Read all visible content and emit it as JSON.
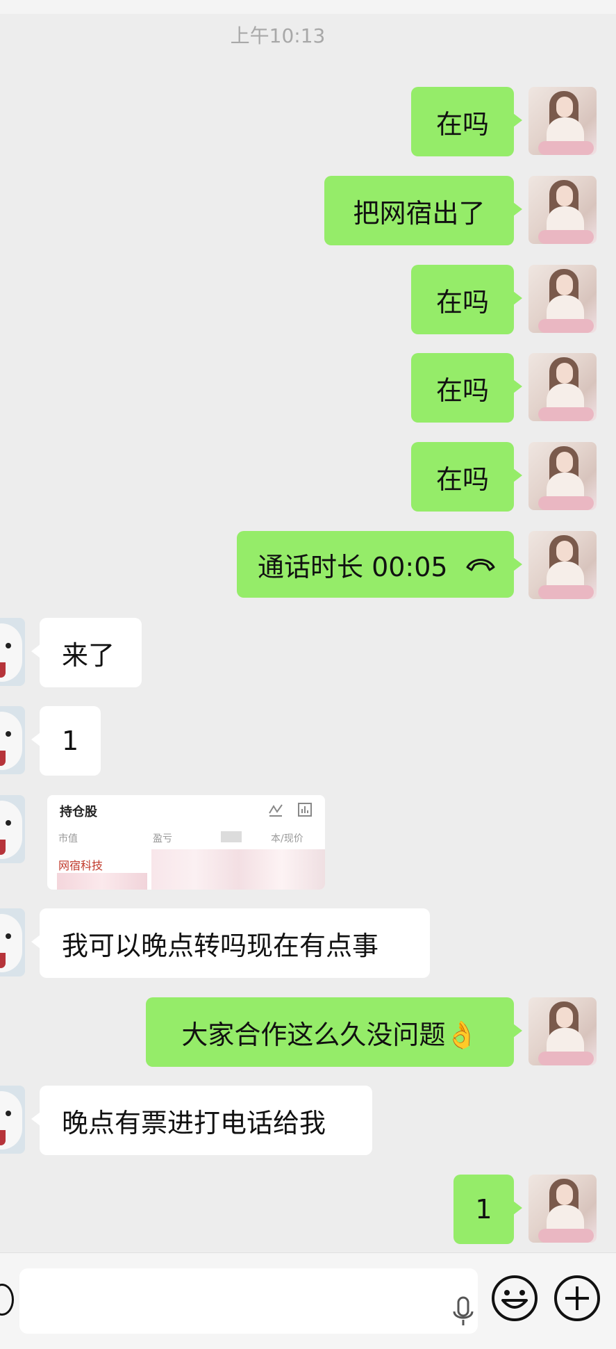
{
  "chat": {
    "timestamp": "上午10:13",
    "messages": [
      {
        "from": "me",
        "text": "在吗"
      },
      {
        "from": "me",
        "text": "把网宿出了"
      },
      {
        "from": "me",
        "text": "在吗"
      },
      {
        "from": "me",
        "text": "在吗"
      },
      {
        "from": "me",
        "text": "在吗"
      },
      {
        "from": "me",
        "type": "call",
        "text": "通话时长 00:05",
        "icon": "phone-hangup-icon"
      },
      {
        "from": "them",
        "text": "来了"
      },
      {
        "from": "them",
        "text": "1"
      },
      {
        "from": "them",
        "type": "screenshot",
        "card": {
          "header": "持仓股",
          "columns": [
            "市值",
            "盈亏",
            "本/现价"
          ],
          "stock_name": "网宿科技"
        }
      },
      {
        "from": "them",
        "text": "我可以晚点转吗现在有点事"
      },
      {
        "from": "me",
        "text": "大家合作这么久没问题👌"
      },
      {
        "from": "them",
        "text": "晚点有票进打电话给我"
      },
      {
        "from": "me",
        "text": "1"
      }
    ]
  },
  "input_bar": {
    "voice_icon": "voice-icon",
    "mic_icon": "microphone-icon",
    "emoji_icon": "emoji-icon",
    "plus_icon": "plus-icon"
  },
  "colors": {
    "background": "#ededed",
    "my_bubble": "#95ec69",
    "their_bubble": "#ffffff"
  }
}
